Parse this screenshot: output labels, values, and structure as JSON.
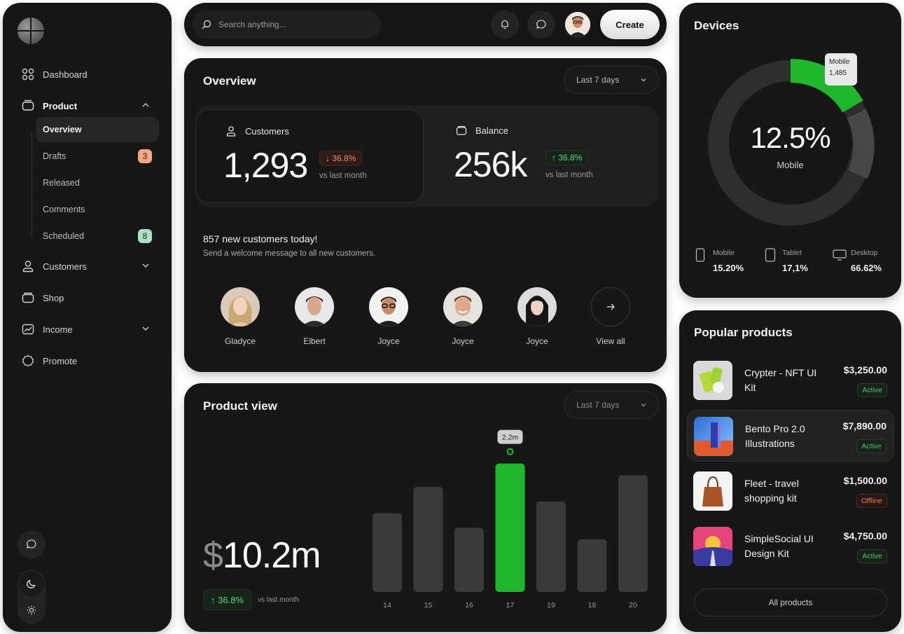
{
  "sidebar": {
    "items": [
      {
        "label": "Dashboard",
        "icon": "grid-icon"
      },
      {
        "label": "Product",
        "icon": "box-icon"
      },
      {
        "label": "Customers",
        "icon": "user-icon"
      },
      {
        "label": "Shop",
        "icon": "shop-icon"
      },
      {
        "label": "Income",
        "icon": "chart-icon"
      },
      {
        "label": "Promote",
        "icon": "badge-icon"
      }
    ],
    "product_sub": [
      {
        "label": "Overview",
        "active": true
      },
      {
        "label": "Drafts",
        "badge": "3",
        "badge_color": "#f7a882"
      },
      {
        "label": "Released"
      },
      {
        "label": "Comments"
      },
      {
        "label": "Scheduled",
        "badge": "8",
        "badge_color": "#a9e3c0"
      }
    ]
  },
  "topbar": {
    "search_placeholder": "Search anything...",
    "create_label": "Create"
  },
  "overview": {
    "title": "Overview",
    "range": "Last 7 days",
    "customers": {
      "label": "Customers",
      "value": "1,293",
      "change": "36.8%",
      "direction": "down",
      "vs": "vs last month"
    },
    "balance": {
      "label": "Balance",
      "value": "256k",
      "change": "36.8%",
      "direction": "up",
      "vs": "vs last month"
    },
    "new_title": "857 new customers today!",
    "new_sub": "Send a welcome message to all new customers.",
    "people": [
      "Gladyce",
      "Elbert",
      "Joyce",
      "Joyce",
      "Joyce"
    ],
    "view_all": "View all"
  },
  "product_view": {
    "title": "Product view",
    "range": "Last 7 days",
    "currency": "$",
    "amount": "10.2m",
    "change": "36.8%",
    "vs": "vs last month",
    "tooltip": "2.2m"
  },
  "chart_data": {
    "type": "bar",
    "categories": [
      "14",
      "15",
      "16",
      "17",
      "19",
      "18",
      "20"
    ],
    "values": [
      1.35,
      1.8,
      1.1,
      2.2,
      1.55,
      0.9,
      2.0
    ],
    "highlight_index": 3,
    "highlight_color": "#1fb82c",
    "bar_color": "#3a3a3a",
    "ylim": [
      0,
      2.4
    ]
  },
  "devices": {
    "title": "Devices",
    "center_value": "12.5%",
    "center_label": "Mobile",
    "tooltip_name": "Mobile",
    "tooltip_value": "1,485",
    "legend": [
      {
        "name": "Mobile",
        "value": "15.20%",
        "icon": "phone-icon"
      },
      {
        "name": "Tablet",
        "value": "17,1%",
        "icon": "tablet-icon"
      },
      {
        "name": "Desktop",
        "value": "66.62%",
        "icon": "desktop-icon"
      }
    ],
    "segment_color": "#1fb82c"
  },
  "popular": {
    "title": "Popular products",
    "products": [
      {
        "name": "Crypter - NFT UI Kit",
        "price": "$3,250.00",
        "status": "Active"
      },
      {
        "name": "Bento Pro 2.0 Illustrations",
        "price": "$7,890.00",
        "status": "Active"
      },
      {
        "name": "Fleet - travel shopping kit",
        "price": "$1,500.00",
        "status": "Offline"
      },
      {
        "name": "SimpleSocial UI Design Kit",
        "price": "$4,750.00",
        "status": "Active"
      }
    ],
    "all_label": "All products"
  }
}
